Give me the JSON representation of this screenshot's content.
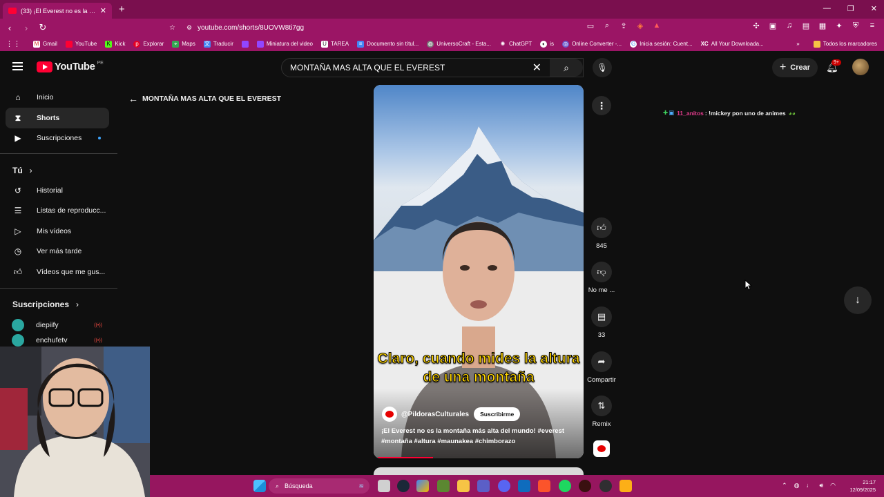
{
  "browser": {
    "tab_title": "(33) ¡El Everest no es la mont",
    "url": "youtube.com/shorts/8UOVW8ti7gg",
    "bookmarks": [
      "Gmail",
      "YouTube",
      "Kick",
      "Explorar",
      "Maps",
      "Traducir",
      "",
      "Miniatura del video",
      "TAREA",
      "Documento sin títul...",
      "UniversoCraft - Esta...",
      "ChatGPT",
      "is",
      "Online Converter -...",
      "Inicia sesión: Cuent...",
      "All Your Downloada..."
    ],
    "bookmarks_folder": "Todos los marcadores"
  },
  "header": {
    "logo_text": "YouTube",
    "region": "PE",
    "search_value": "MONTAÑA MAS ALTA QUE EL EVEREST",
    "create_label": "Crear",
    "notif_count": "9+"
  },
  "sidebar": {
    "inicio": "Inicio",
    "shorts": "Shorts",
    "suscripciones": "Suscripciones",
    "tu": "Tú",
    "historial": "Historial",
    "listas": "Listas de reproducc...",
    "mis_videos": "Mis vídeos",
    "ver_mas_tarde": "Ver más tarde",
    "me_gusta": "Vídeos que me gus...",
    "subs_header": "Suscripciones",
    "subs": [
      "diepiify",
      "enchufetv"
    ],
    "live_marker": "((•))"
  },
  "main": {
    "back_label": "MONTAÑA MAS ALTA QUE EL EVEREST",
    "caption": "Claro, cuando mides la altura de una montaña",
    "channel": "@PildorasCulturales",
    "subscribe": "Suscribirme",
    "description": "¡El Everest no es la montaña más alta del mundo! #everest #montaña #altura #maunakea #chimborazo",
    "likes": "845",
    "dislike": "No me ...",
    "comments": "33",
    "share": "Compartir",
    "remix": "Remix"
  },
  "chat": {
    "user": "11_anitos",
    "message": ": !mickey pon uno de animes"
  },
  "taskbar": {
    "search": "Búsqueda",
    "time": "21:17",
    "date": "12/09/2025"
  },
  "colors": {
    "browser_accent": "#9b1565",
    "youtube_red": "#ff0033",
    "caption_yellow": "#ffd400"
  }
}
